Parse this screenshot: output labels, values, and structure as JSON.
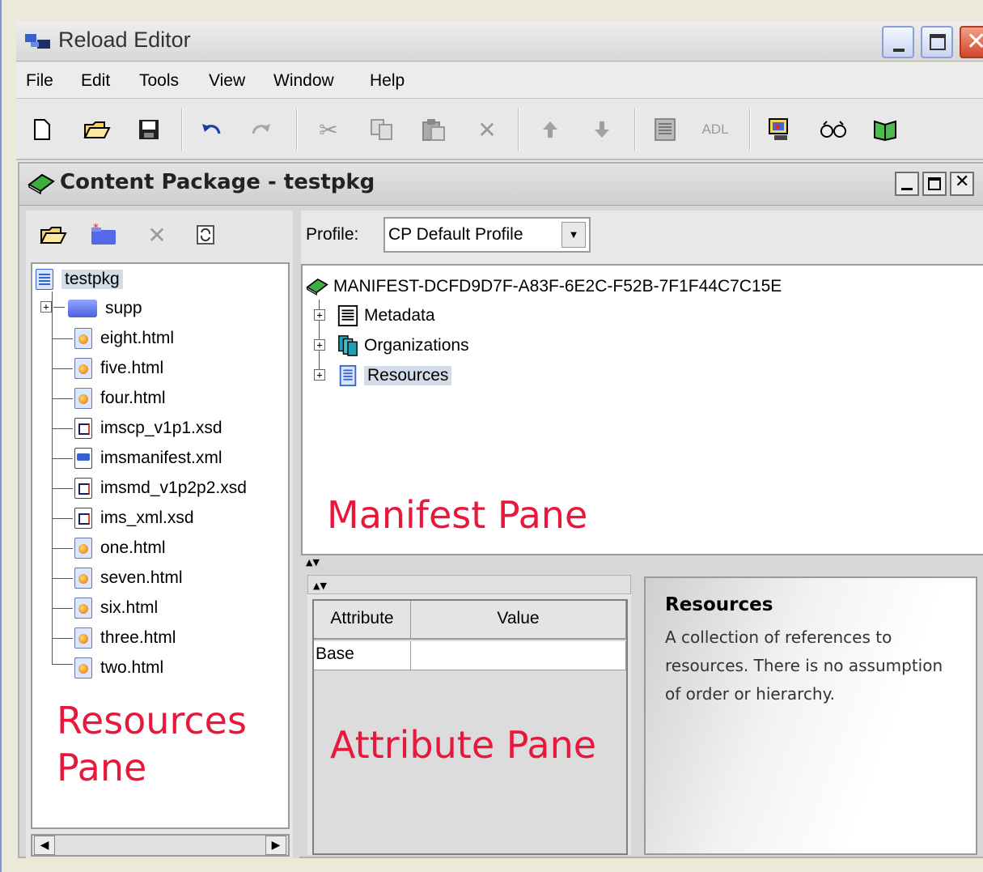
{
  "window": {
    "title": "Reload Editor"
  },
  "menu": [
    "File",
    "Edit",
    "Tools",
    "View",
    "Window",
    "Help"
  ],
  "toolbar": {
    "adl_label": "ADL",
    "icons": [
      "new-file-icon",
      "open-folder-icon",
      "save-icon",
      "undo-icon",
      "redo-icon",
      "cut-icon",
      "copy-icon",
      "paste-icon",
      "delete-icon",
      "move-up-icon",
      "move-down-icon",
      "metadata-icon",
      "adl-icon",
      "preview-icon",
      "view-icon",
      "book-icon"
    ]
  },
  "frame": {
    "title": "Content Package - testpkg"
  },
  "resources": {
    "root": "testpkg",
    "items": [
      {
        "label": "supp",
        "type": "folder"
      },
      {
        "label": "eight.html",
        "type": "html"
      },
      {
        "label": "five.html",
        "type": "html"
      },
      {
        "label": "four.html",
        "type": "html"
      },
      {
        "label": "imscp_v1p1.xsd",
        "type": "xsd"
      },
      {
        "label": "imsmanifest.xml",
        "type": "xml"
      },
      {
        "label": "imsmd_v1p2p2.xsd",
        "type": "xsd"
      },
      {
        "label": "ims_xml.xsd",
        "type": "xsd"
      },
      {
        "label": "one.html",
        "type": "html"
      },
      {
        "label": "seven.html",
        "type": "html"
      },
      {
        "label": "six.html",
        "type": "html"
      },
      {
        "label": "three.html",
        "type": "html"
      },
      {
        "label": "two.html",
        "type": "html"
      }
    ]
  },
  "profile": {
    "label": "Profile:",
    "value": "CP Default Profile"
  },
  "manifest": {
    "root": "MANIFEST-DCFD9D7F-A83F-6E2C-F52B-7F1F44C7C15E",
    "children": [
      "Metadata",
      "Organizations",
      "Resources"
    ]
  },
  "attributes": {
    "headers": [
      "Attribute",
      "Value"
    ],
    "rows": [
      [
        "Base",
        ""
      ]
    ]
  },
  "help": {
    "title": "Resources",
    "description": "A collection of references to resources. There is no assumption of order or hierarchy."
  },
  "annotations": {
    "resources_pane_line1": "Resources",
    "resources_pane_line2": "Pane",
    "manifest_pane": "Manifest Pane",
    "attribute_pane": "Attribute Pane"
  },
  "colors": {
    "annotation": "#e8183c",
    "selection": "#d2dde8"
  }
}
